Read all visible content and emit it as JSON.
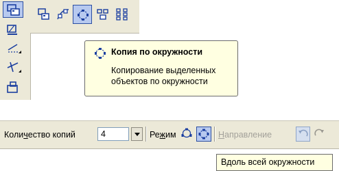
{
  "tooltip": {
    "icon": "copy-around-circle-icon",
    "title": "Копия по окружности",
    "description": "Копирование выделенных объектов по окружности"
  },
  "vertical_toolbar": {
    "icons": [
      "copy-group-icon",
      "hatch-icon",
      "edit-line-icon",
      "trim-line-icon",
      "block-icon"
    ],
    "active_index": 0
  },
  "horizontal_toolbar": {
    "icons": [
      "copy-icon",
      "copy-along-curve-icon",
      "copy-around-circle-icon",
      "copy-group-icon",
      "copy-array-icon"
    ],
    "active_index": 2
  },
  "property_bar": {
    "copies_label": "Количество копий",
    "copies_value": "4",
    "mode_label": "Режим",
    "direction_label": "Направление"
  },
  "hint": {
    "text": "Вдоль всей окружности"
  },
  "colors": {
    "toolbar_bg": "#ece9d8",
    "tooltip_bg": "#ffffe1",
    "active_button_bg": "#b7c9ef",
    "active_button_border": "#2b4ea2",
    "disabled_text": "#a3a19a"
  }
}
